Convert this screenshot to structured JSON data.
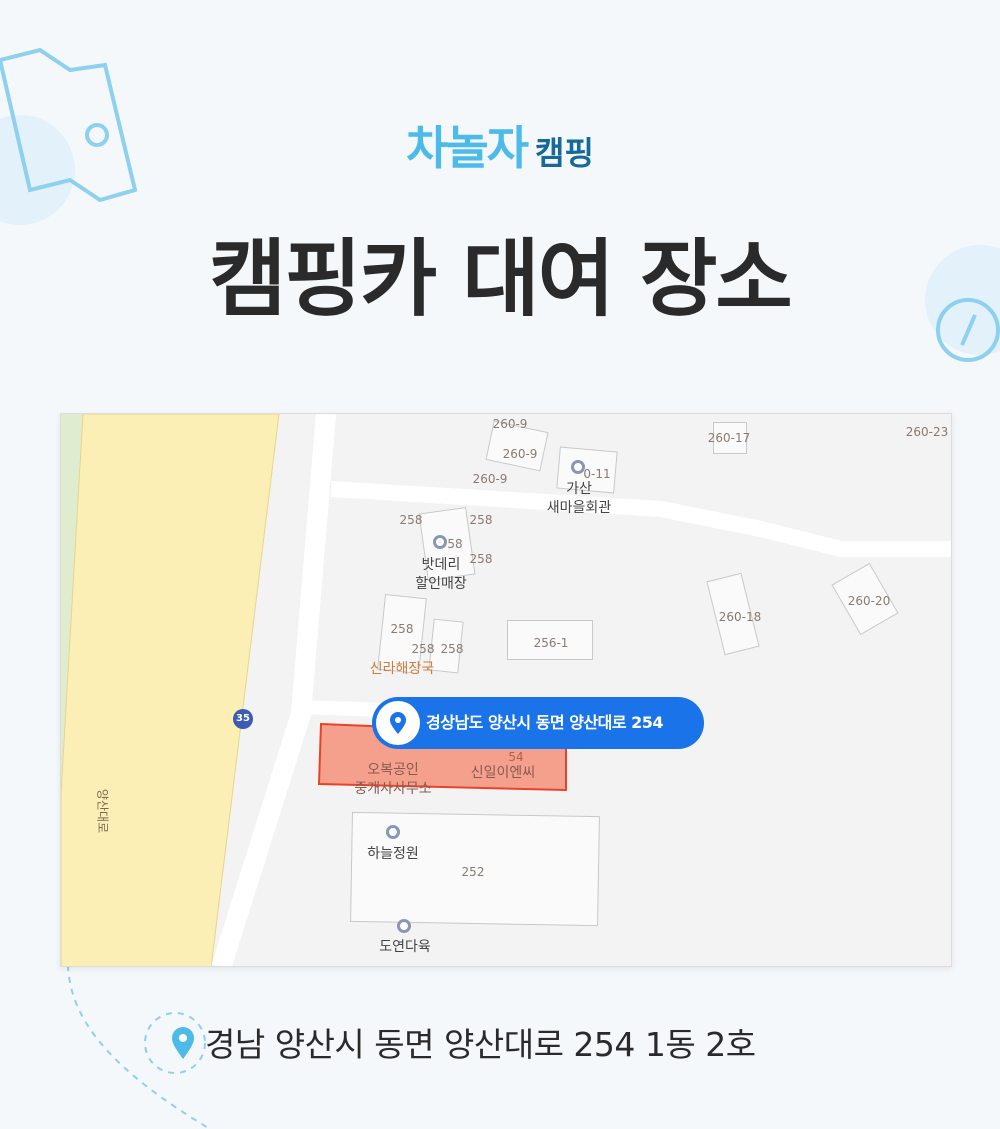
{
  "brand": {
    "logo": "차놀자",
    "sub": "캠핑"
  },
  "title": "캠핑카 대여 장소",
  "map": {
    "labels": [
      "260-9",
      "260-9",
      "260-9",
      "260-17",
      "260-23",
      "0-11",
      "가산",
      "새마을회관",
      "258",
      "58",
      "258",
      "258",
      "밧데리",
      "할인매장",
      "258",
      "258",
      "258",
      "신라해장국",
      "256-1",
      "260-18",
      "260-20",
      "35",
      "양산대로",
      "오복공인",
      "중개사사무소",
      "54",
      "신일이엔씨",
      "하늘정원",
      "252",
      "도연다육"
    ],
    "callout": "경상남도 양산시 동면 양산대로 254",
    "highlight_color": "#f4a08c",
    "callout_color": "#1a73e8"
  },
  "address": "경남 양산시 동면 양산대로 254 1동 2호",
  "accent": "#4dbbea"
}
